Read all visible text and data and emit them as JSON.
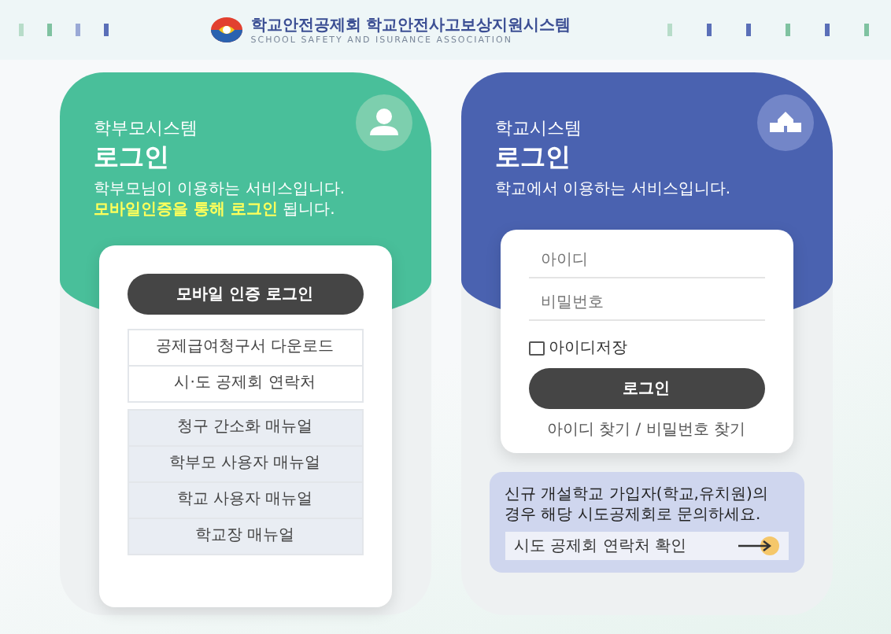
{
  "header": {
    "title": "학교안전공제회 학교안전사고보상지원시스템",
    "subtitle": "SCHOOL SAFETY AND ISURANCE ASSOCIATION"
  },
  "parent": {
    "system": "학부모시스템",
    "title": "로그인",
    "description": "학부모님이 이용하는 서비스입니다.",
    "highlight": {
      "strong": "모바일인증을 통해 로그인",
      "rest": " 됩니다."
    },
    "button": "모바일 인증 로그인",
    "links": [
      {
        "label": "공제급여청구서 다운로드",
        "kind": "link"
      },
      {
        "label": "시·도 공제회 연락처",
        "kind": "link"
      },
      {
        "label": "청구 간소화 매뉴얼",
        "kind": "manual"
      },
      {
        "label": "학부모 사용자 매뉴얼",
        "kind": "manual"
      },
      {
        "label": "학교 사용자 매뉴얼",
        "kind": "manual"
      },
      {
        "label": "학교장 매뉴얼",
        "kind": "manual"
      }
    ]
  },
  "school": {
    "system": "학교시스템",
    "title": "로그인",
    "description": "학교에서 이용하는 서비스입니다.",
    "id_field": {
      "placeholder": "아이디"
    },
    "password_field": {
      "placeholder": "비밀번호"
    },
    "remember": {
      "label": "아이디저장",
      "checked": false
    },
    "button": "로그인",
    "find_link": "아이디 찾기 / 비밀번호 찾기",
    "notice": {
      "text": "신규 개설학교 가입자(학교,유치원)의 경우 해당 시도공제회로 문의하세요.",
      "link": "시도 공제회 연락처 확인"
    }
  }
}
